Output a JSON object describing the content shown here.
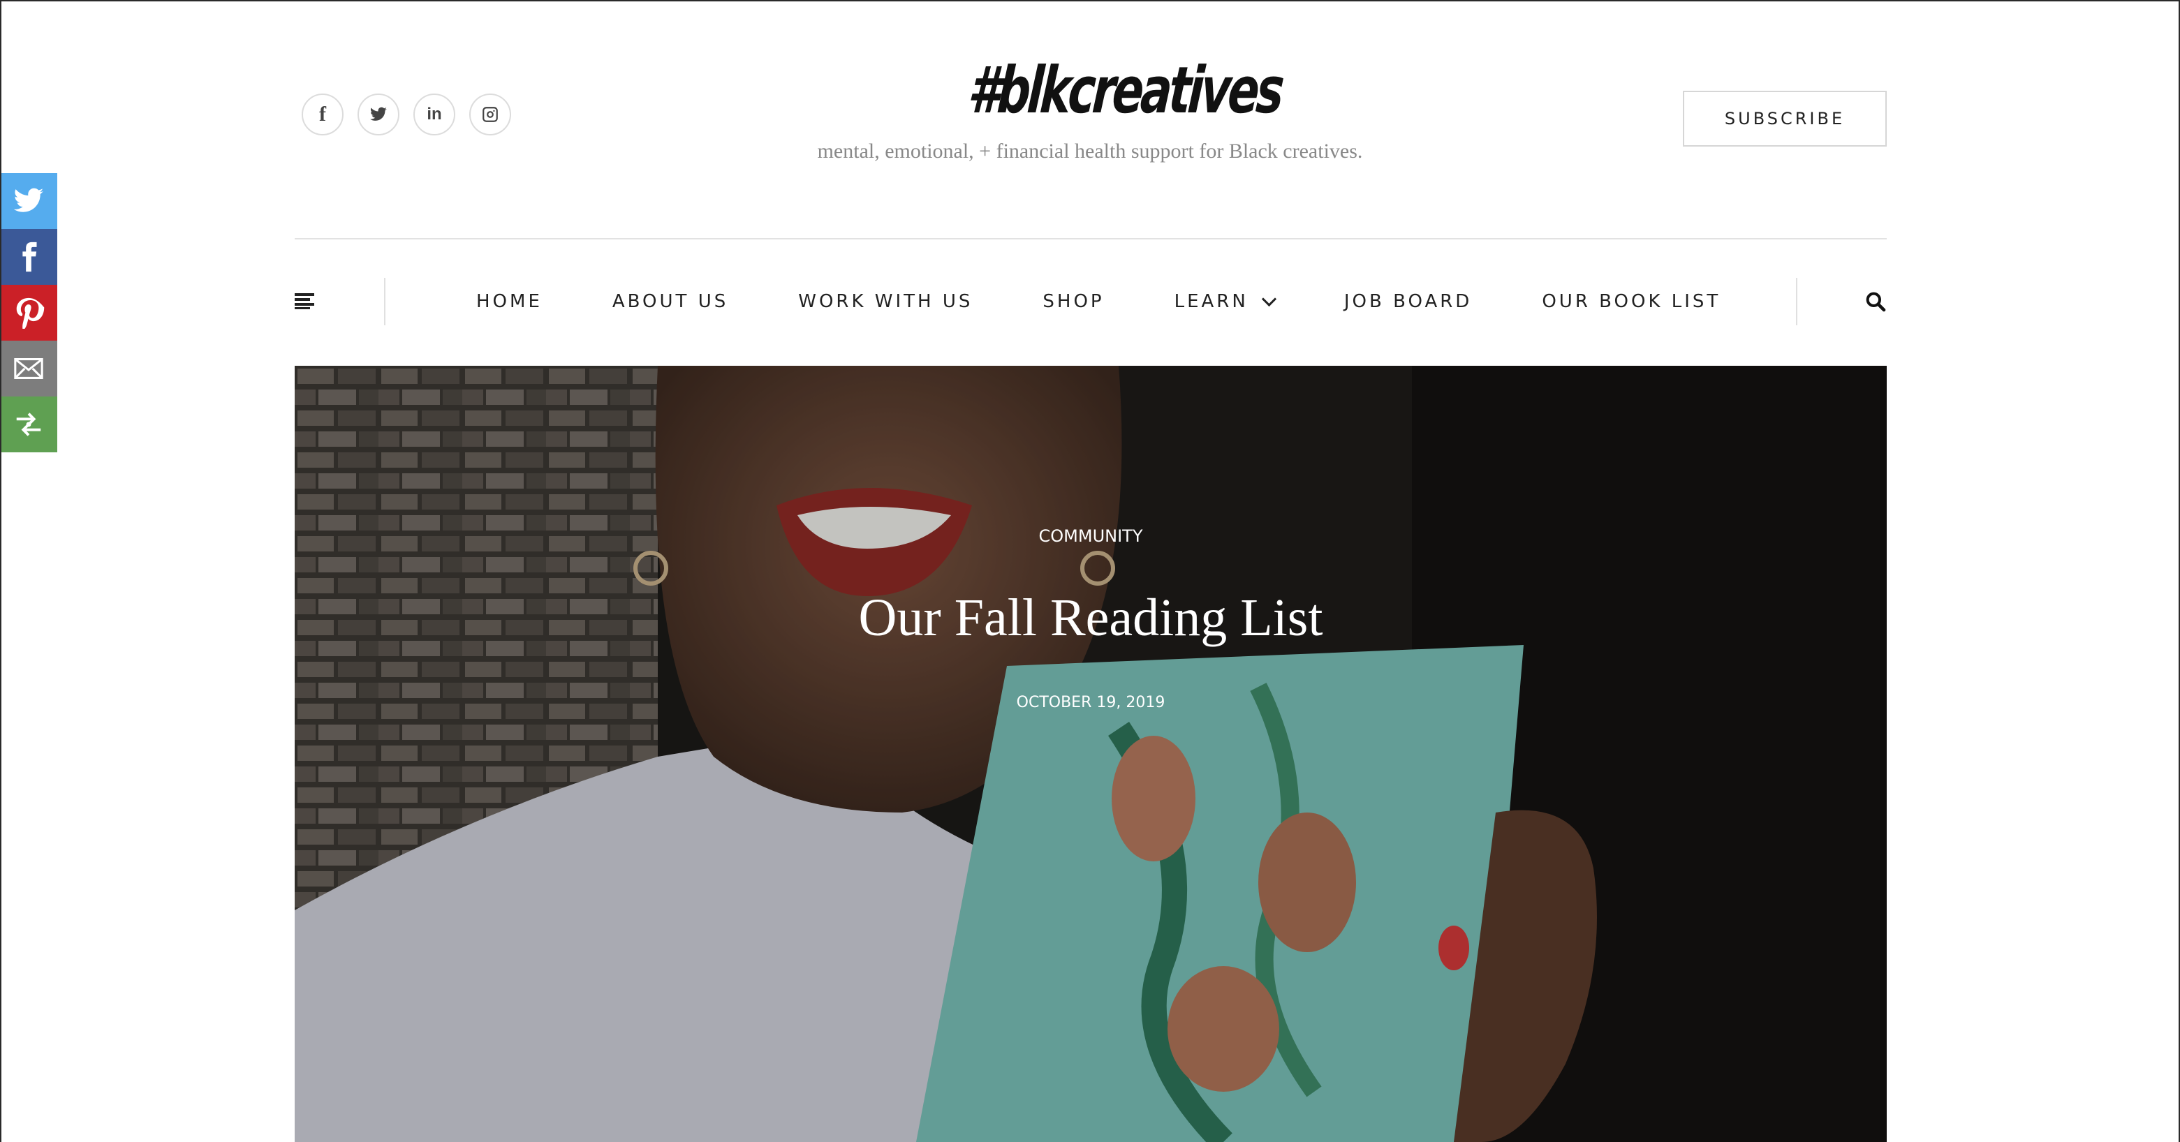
{
  "social_top": [
    {
      "name": "facebook-icon",
      "glyph": "f"
    },
    {
      "name": "twitter-icon",
      "glyph": ""
    },
    {
      "name": "linkedin-icon",
      "glyph": "in"
    },
    {
      "name": "instagram-icon",
      "glyph": ""
    }
  ],
  "logo": {
    "text": "#blkcreatives"
  },
  "tagline": "mental, emotional, + financial health support for Black creatives.",
  "subscribe_label": "SUBSCRIBE",
  "nav": {
    "items": [
      "HOME",
      "ABOUT US",
      "WORK WITH US",
      "SHOP",
      "LEARN",
      "JOB BOARD",
      "OUR BOOK LIST"
    ]
  },
  "hero": {
    "category": "COMMUNITY",
    "title": "Our Fall Reading List",
    "date": "OCTOBER 19, 2019"
  },
  "share_bar": [
    {
      "name": "twitter-share-icon",
      "color": "#55acee"
    },
    {
      "name": "facebook-share-icon",
      "color": "#3b5998"
    },
    {
      "name": "pinterest-share-icon",
      "color": "#cb2027"
    },
    {
      "name": "email-share-icon",
      "color": "#7d7d7d"
    },
    {
      "name": "more-share-icon",
      "color": "#5fa052"
    }
  ],
  "colors": {
    "accent": "#222222",
    "tagline": "#888888",
    "divider": "#e2e2e2"
  }
}
